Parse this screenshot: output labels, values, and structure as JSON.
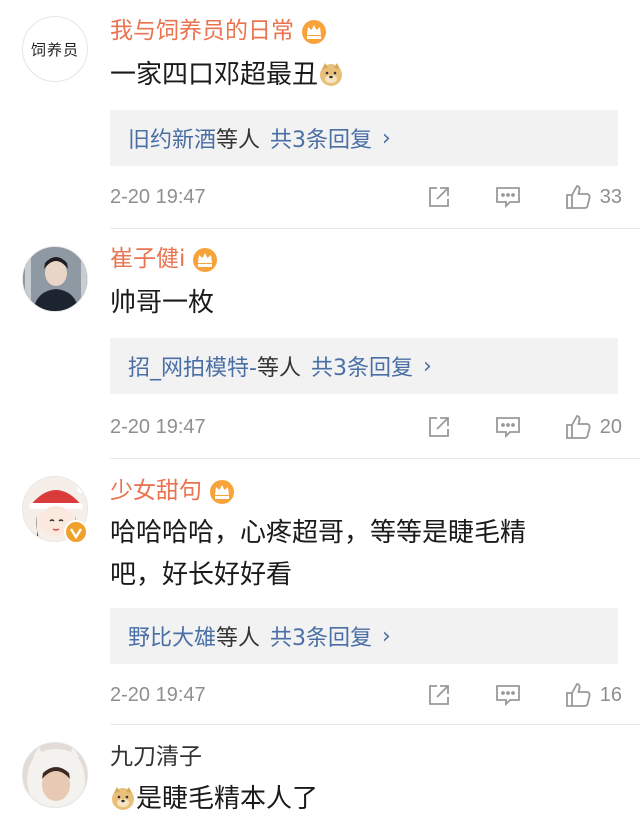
{
  "comments": [
    {
      "username": "我与饲养员的日常",
      "avatar_text": "饲养员",
      "text": "一家四口邓超最丑",
      "reply": {
        "names": "旧约新酒",
        "and": "等人",
        "count": "共3条回复",
        "chevron": "›"
      },
      "time": "2-20 19:47",
      "likes": "33"
    },
    {
      "username": "崔子健i",
      "text": "帅哥一枚",
      "reply": {
        "names": "招_网拍模特-",
        "and": "等人",
        "count": "共3条回复",
        "chevron": "›"
      },
      "time": "2-20 19:47",
      "likes": "20"
    },
    {
      "username": "少女甜句",
      "text_line1": "哈哈哈哈，心疼超哥，等等是睫毛精",
      "text_line2": "吧，好长好好看",
      "reply": {
        "names": "野比大雄",
        "and": "等人",
        "count": "共3条回复",
        "chevron": "›"
      },
      "time": "2-20 19:47",
      "likes": "16"
    },
    {
      "username": "九刀清子",
      "text": "是睫毛精本人了"
    }
  ],
  "colors": {
    "username_accent": "#eb7350",
    "link": "#4a6fa5",
    "meta": "#8f8f8f",
    "reply_bg": "#f2f2f2"
  },
  "icons": [
    "crown-badge-icon",
    "doge-emoji-icon",
    "share-icon",
    "comment-icon",
    "like-icon",
    "verified-icon"
  ]
}
